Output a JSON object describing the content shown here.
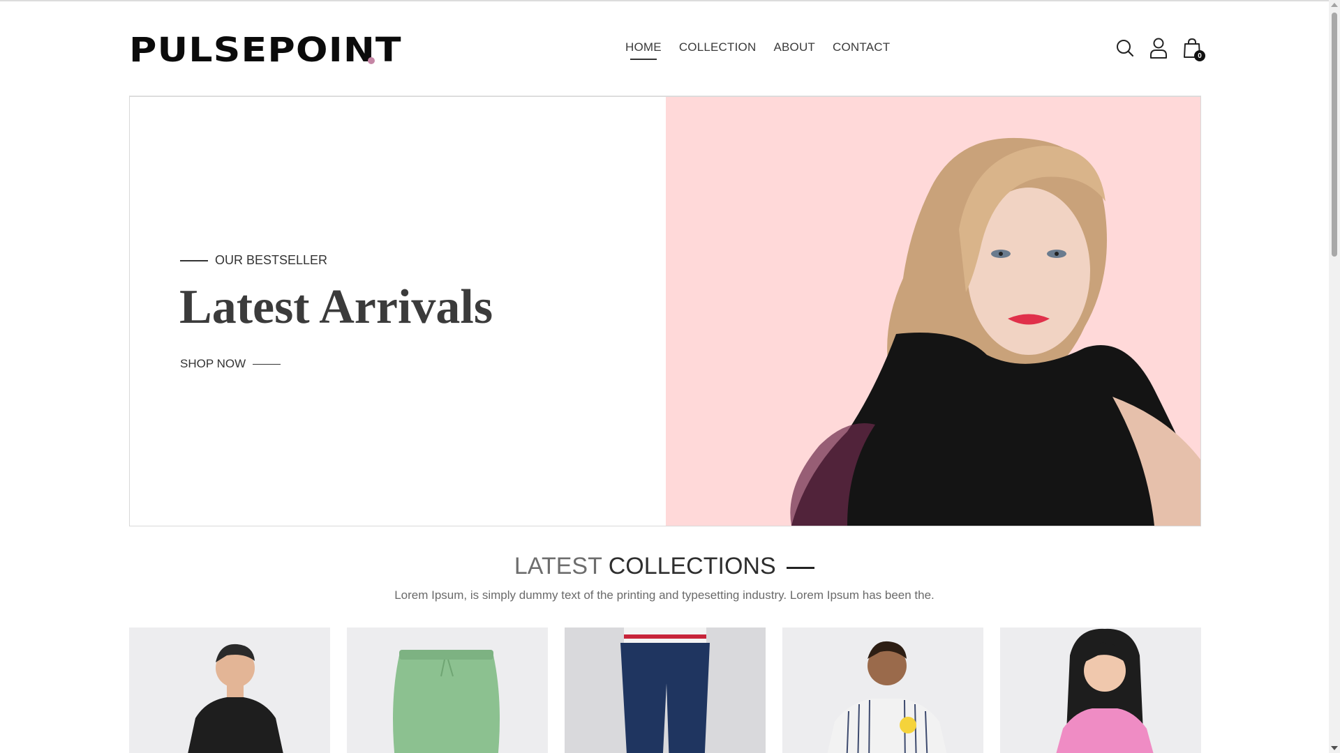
{
  "brand": {
    "name": "PULSEPOINT",
    "dot_color": "#c586a5"
  },
  "nav": {
    "items": [
      {
        "label": "HOME",
        "active": true
      },
      {
        "label": "COLLECTION",
        "active": false
      },
      {
        "label": "ABOUT",
        "active": false
      },
      {
        "label": "CONTACT",
        "active": false
      }
    ]
  },
  "header_icons": {
    "search": "search-icon",
    "profile": "user-icon",
    "cart": "shopping-bag-icon",
    "cart_count": "0"
  },
  "hero": {
    "eyebrow": "OUR BESTSELLER",
    "title": "Latest Arrivals",
    "cta": "SHOP NOW",
    "image_background": "#ffd9d9"
  },
  "collections": {
    "title_light": "LATEST",
    "title_dark": "COLLECTIONS",
    "subtitle": "Lorem Ipsum, is simply dummy text of the printing and typesetting industry. Lorem Ipsum has been the."
  },
  "products": [
    {
      "image": "boy in black t-shirt"
    },
    {
      "image": "green pants"
    },
    {
      "image": "navy jogger pants"
    },
    {
      "image": "boy in striped pikachu shirt"
    },
    {
      "image": "girl in pink top"
    }
  ],
  "colors": {
    "accent": "#c586a5",
    "hero_bg": "#ffd9d9",
    "product_bg": "#ededef"
  }
}
